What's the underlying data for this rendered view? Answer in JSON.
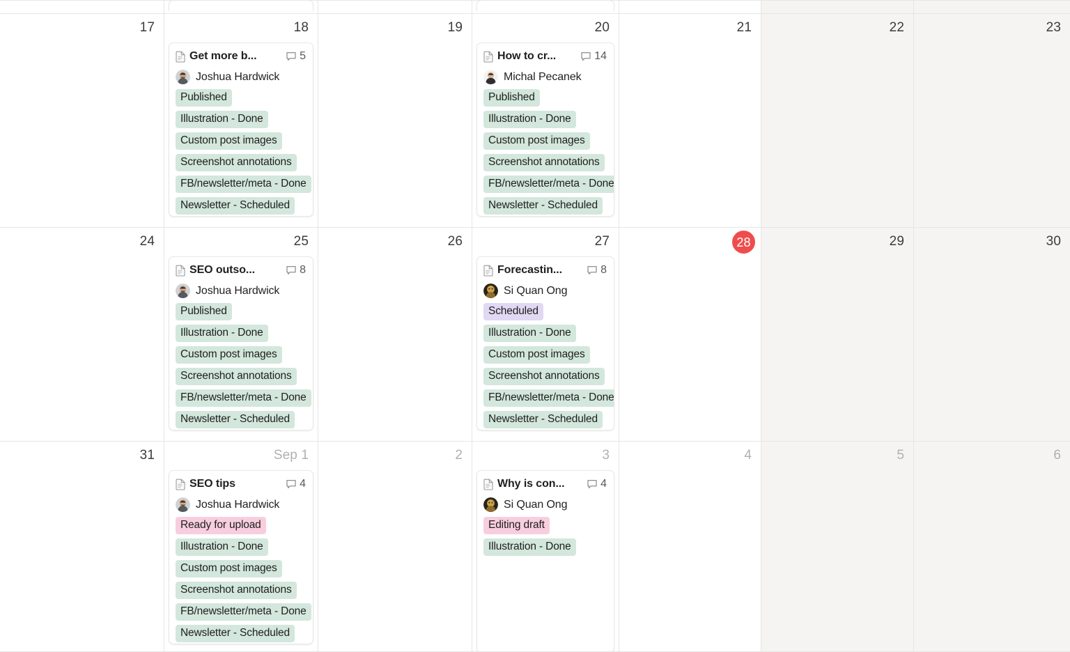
{
  "view": {
    "type": "calendar-month",
    "today_date": "28",
    "colors": {
      "tag_green": "#d3e7dc",
      "tag_purple": "#e1d8f3",
      "tag_pink": "#f8cede",
      "today_badge": "#ef4d4d",
      "weekend_cell": "#f5f4f2",
      "grid_line": "#e6e6e6"
    }
  },
  "rows": [
    {
      "name": "partial-row-top",
      "cells": [
        {
          "date": "",
          "muted": false,
          "weekend": false,
          "stub": false
        },
        {
          "date": "",
          "muted": false,
          "weekend": false,
          "stub": true
        },
        {
          "date": "",
          "muted": false,
          "weekend": false,
          "stub": false
        },
        {
          "date": "",
          "muted": false,
          "weekend": false,
          "stub": true
        },
        {
          "date": "",
          "muted": false,
          "weekend": false,
          "stub": false
        },
        {
          "date": "",
          "muted": false,
          "weekend": true,
          "stub": false
        },
        {
          "date": "",
          "muted": false,
          "weekend": true,
          "stub": false
        }
      ]
    },
    {
      "name": "week-aug-17-23",
      "cells": [
        {
          "date": "17",
          "muted": false,
          "weekend": false,
          "today": false
        },
        {
          "date": "18",
          "muted": false,
          "weekend": false,
          "today": false,
          "card": {
            "title": "Get more b...",
            "comments": "5",
            "author": "Joshua Hardwick",
            "avatar": "photo-joshua",
            "tags": [
              {
                "label": "Published",
                "color": "green"
              },
              {
                "label": "Illustration - Done",
                "color": "green"
              },
              {
                "label": "Custom post images",
                "color": "green"
              },
              {
                "label": "Screenshot annotations",
                "color": "green"
              },
              {
                "label": "FB/newsletter/meta - Done",
                "color": "green"
              },
              {
                "label": "Newsletter - Scheduled",
                "color": "green"
              }
            ]
          }
        },
        {
          "date": "19",
          "muted": false,
          "weekend": false,
          "today": false
        },
        {
          "date": "20",
          "muted": false,
          "weekend": false,
          "today": false,
          "card": {
            "title": "How to cr...",
            "comments": "14",
            "author": "Michal Pecanek",
            "avatar": "photo-michal",
            "tags": [
              {
                "label": "Published",
                "color": "green"
              },
              {
                "label": "Illustration - Done",
                "color": "green"
              },
              {
                "label": "Custom post images",
                "color": "green"
              },
              {
                "label": "Screenshot annotations",
                "color": "green"
              },
              {
                "label": "FB/newsletter/meta - Done",
                "color": "green"
              },
              {
                "label": "Newsletter - Scheduled",
                "color": "green"
              }
            ]
          }
        },
        {
          "date": "21",
          "muted": false,
          "weekend": false,
          "today": false
        },
        {
          "date": "22",
          "muted": false,
          "weekend": true,
          "today": false
        },
        {
          "date": "23",
          "muted": false,
          "weekend": true,
          "today": false
        }
      ]
    },
    {
      "name": "week-aug-24-30",
      "cells": [
        {
          "date": "24",
          "muted": false,
          "weekend": false,
          "today": false
        },
        {
          "date": "25",
          "muted": false,
          "weekend": false,
          "today": false,
          "card": {
            "title": "SEO outso...",
            "comments": "8",
            "author": "Joshua Hardwick",
            "avatar": "photo-joshua",
            "tags": [
              {
                "label": "Published",
                "color": "green"
              },
              {
                "label": "Illustration - Done",
                "color": "green"
              },
              {
                "label": "Custom post images",
                "color": "green"
              },
              {
                "label": "Screenshot annotations",
                "color": "green"
              },
              {
                "label": "FB/newsletter/meta - Done",
                "color": "green"
              },
              {
                "label": "Newsletter - Scheduled",
                "color": "green"
              }
            ]
          }
        },
        {
          "date": "26",
          "muted": false,
          "weekend": false,
          "today": false
        },
        {
          "date": "27",
          "muted": false,
          "weekend": false,
          "today": false,
          "card": {
            "title": "Forecastin...",
            "comments": "8",
            "author": "Si Quan Ong",
            "avatar": "photo-siquan",
            "tags": [
              {
                "label": "Scheduled",
                "color": "purple"
              },
              {
                "label": "Illustration - Done",
                "color": "green"
              },
              {
                "label": "Custom post images",
                "color": "green"
              },
              {
                "label": "Screenshot annotations",
                "color": "green"
              },
              {
                "label": "FB/newsletter/meta - Done",
                "color": "green"
              },
              {
                "label": "Newsletter - Scheduled",
                "color": "green"
              }
            ]
          }
        },
        {
          "date": "28",
          "muted": false,
          "weekend": false,
          "today": true
        },
        {
          "date": "29",
          "muted": false,
          "weekend": true,
          "today": false
        },
        {
          "date": "30",
          "muted": false,
          "weekend": true,
          "today": false
        }
      ]
    },
    {
      "name": "week-aug-31-sep-6",
      "cells": [
        {
          "date": "31",
          "muted": false,
          "weekend": false,
          "today": false
        },
        {
          "date": "Sep 1",
          "muted": true,
          "weekend": false,
          "today": false,
          "card": {
            "title": "SEO tips",
            "comments": "4",
            "author": "Joshua Hardwick",
            "avatar": "photo-joshua",
            "tags": [
              {
                "label": "Ready for upload",
                "color": "pink"
              },
              {
                "label": "Illustration - Done",
                "color": "green"
              },
              {
                "label": "Custom post images",
                "color": "green"
              },
              {
                "label": "Screenshot annotations",
                "color": "green"
              },
              {
                "label": "FB/newsletter/meta - Done",
                "color": "green"
              },
              {
                "label": "Newsletter - Scheduled",
                "color": "green"
              }
            ]
          }
        },
        {
          "date": "2",
          "muted": true,
          "weekend": false,
          "today": false
        },
        {
          "date": "3",
          "muted": true,
          "weekend": false,
          "today": false,
          "card": {
            "title": "Why is con...",
            "comments": "4",
            "author": "Si Quan Ong",
            "avatar": "photo-siquan",
            "tags": [
              {
                "label": "Editing draft",
                "color": "pink"
              },
              {
                "label": "Illustration - Done",
                "color": "green"
              }
            ]
          }
        },
        {
          "date": "4",
          "muted": true,
          "weekend": false,
          "today": false
        },
        {
          "date": "5",
          "muted": true,
          "weekend": true,
          "today": false
        },
        {
          "date": "6",
          "muted": true,
          "weekend": true,
          "today": false
        }
      ]
    }
  ]
}
